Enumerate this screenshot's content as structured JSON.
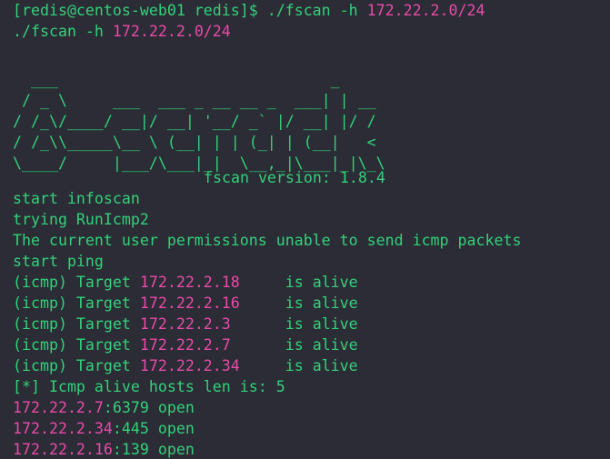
{
  "terminal": {
    "prompt": {
      "text": "[redis@centos-web01 redis]$ ./fscan -h ",
      "ip": "172.22.2.0/24"
    },
    "echo": {
      "text": "./fscan -h ",
      "ip": "172.22.2.0/24"
    },
    "banner": [
      "  ___                              _",
      " / _ \\     ___  ___ _ __ __ _  ___| | __",
      "/ /_\\/____/ __|/ __| '__/ _` |/ __| |/ /",
      "/ /_\\\\_____\\__ \\ (__| | | (_| | (__|   <",
      "\\____/     |___/\\___|_|  \\__,_|\\___|_|\\_\\"
    ],
    "version": "fscan version: 1.8.4",
    "messages": [
      "start infoscan",
      "trying RunIcmp2",
      "The current user permissions unable to send icmp packets",
      "start ping"
    ],
    "icmp": [
      {
        "prefix": "(icmp) Target ",
        "ip": "172.22.2.18",
        "pad": "     ",
        "status": "is alive"
      },
      {
        "prefix": "(icmp) Target ",
        "ip": "172.22.2.16",
        "pad": "     ",
        "status": "is alive"
      },
      {
        "prefix": "(icmp) Target ",
        "ip": "172.22.2.3",
        "pad": "      ",
        "status": "is alive"
      },
      {
        "prefix": "(icmp) Target ",
        "ip": "172.22.2.7",
        "pad": "      ",
        "status": "is alive"
      },
      {
        "prefix": "(icmp) Target ",
        "ip": "172.22.2.34",
        "pad": "     ",
        "status": "is alive"
      }
    ],
    "summary": "[*] Icmp alive hosts len is: 5",
    "ports": [
      {
        "ip": "172.22.2.7",
        "port": ":6379 open"
      },
      {
        "ip": "172.22.2.34",
        "port": ":445 open"
      },
      {
        "ip": "172.22.2.16",
        "port": ":139 open"
      }
    ]
  },
  "colors": {
    "background": "#2b2c35",
    "text_green": "#33d17a",
    "ip_magenta": "#ea4aa8"
  }
}
